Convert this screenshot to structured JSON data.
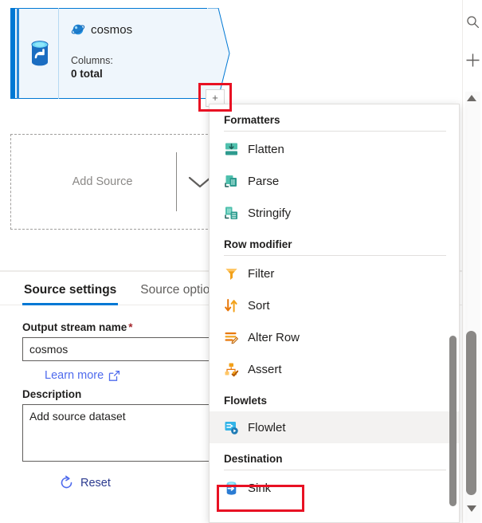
{
  "canvas": {
    "source_card": {
      "title": "cosmos",
      "icon": "cosmos-db-icon",
      "left_icon": "source-database-icon",
      "meta_label": "Columns:",
      "meta_value": "0 total",
      "add_handle_glyph": "+",
      "highlight_color": "#e81123"
    },
    "add_source": {
      "label": "Add Source",
      "chevron_icon": "chevron-down-icon"
    }
  },
  "settings": {
    "tabs": [
      {
        "label": "Source settings",
        "active": true
      },
      {
        "label": "Source options",
        "active": false
      }
    ],
    "output_stream": {
      "label": "Output stream name",
      "required_marker": "*",
      "value": "cosmos",
      "placeholder": "Output stream name"
    },
    "learn_more": {
      "label": "Learn more",
      "icon": "external-link-icon"
    },
    "description": {
      "label": "Description",
      "value": "Add source dataset",
      "placeholder": "Add source dataset"
    },
    "reset": {
      "label": "Reset",
      "icon": "reset-circular-arrow-icon"
    }
  },
  "flyout": {
    "groups": [
      {
        "heading": "Formatters",
        "items": [
          {
            "label": "Flatten",
            "icon": "flatten-icon",
            "color": "#2e9b8f",
            "hovered": false
          },
          {
            "label": "Parse",
            "icon": "parse-icon",
            "color": "#2e9b8f",
            "hovered": false
          },
          {
            "label": "Stringify",
            "icon": "stringify-icon",
            "color": "#2e9b8f",
            "hovered": false
          }
        ]
      },
      {
        "heading": "Row modifier",
        "items": [
          {
            "label": "Filter",
            "icon": "filter-funnel-icon",
            "color": "#f2a11a",
            "hovered": false
          },
          {
            "label": "Sort",
            "icon": "sort-arrows-icon",
            "color": "#e8780a",
            "hovered": false
          },
          {
            "label": "Alter Row",
            "icon": "alter-row-icon",
            "color": "#e8780a",
            "hovered": false
          },
          {
            "label": "Assert",
            "icon": "assert-icon",
            "color": "#f2a11a",
            "hovered": false
          }
        ]
      },
      {
        "heading": "Flowlets",
        "items": [
          {
            "label": "Flowlet",
            "icon": "flowlet-icon",
            "color": "#32b4e8",
            "hovered": true
          }
        ]
      },
      {
        "heading": "Destination",
        "items": [
          {
            "label": "Sink",
            "icon": "sink-database-icon",
            "color": "#2b7cd3",
            "hovered": false,
            "highlighted": true
          }
        ]
      }
    ],
    "highlight_color": "#e81123",
    "scrollbar": {
      "visible": true
    }
  },
  "rail": {
    "buttons": [
      {
        "name": "search",
        "icon": "search-magnifier-icon"
      },
      {
        "name": "zoom-in",
        "icon": "plus-icon"
      }
    ],
    "scrollbar": {
      "up_icon": "triangle-up-icon",
      "down_icon": "triangle-down-icon"
    }
  }
}
